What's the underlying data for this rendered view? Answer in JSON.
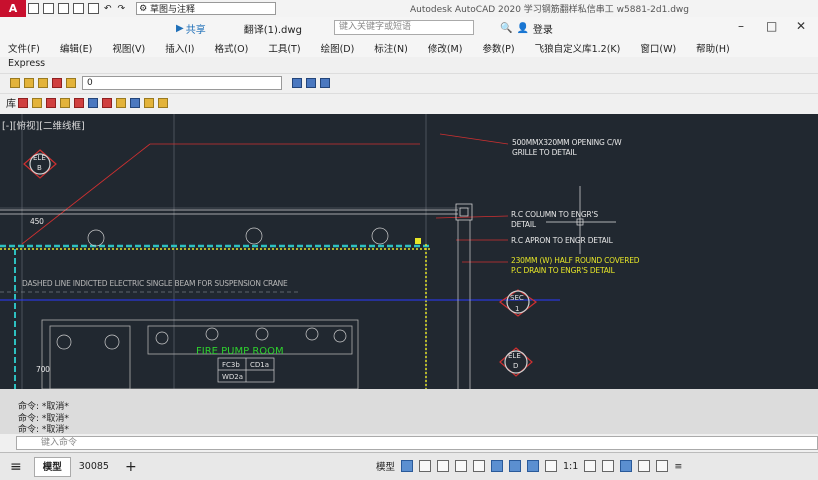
{
  "titlebar": {
    "app_logo": "A",
    "workspace": "草图与注释",
    "window_title": "Autodesk AutoCAD 2020  学习钢筋翻样私信串工    w5881-2d1.dwg"
  },
  "filetab": {
    "share_label": "共享",
    "file_name": "翻译(1).dwg",
    "search_placeholder": "键入关键字或短语",
    "login_label": "登录"
  },
  "menu": [
    "文件(F)",
    "编辑(E)",
    "视图(V)",
    "插入(I)",
    "格式(O)",
    "工具(T)",
    "绘图(D)",
    "标注(N)",
    "修改(M)",
    "参数(P)",
    "飞狼自定义库1.2(K)",
    "窗口(W)",
    "帮助(H)"
  ],
  "express_label": "Express",
  "layer": {
    "current": "0"
  },
  "toolrow2_label": "库",
  "viewport_label": "[-][俯视][二维线框]",
  "drawing": {
    "note1_line1": "500MMX320MM OPENING C/W",
    "note1_line2": "GRILLE TO DETAIL",
    "note2_line1": "R.C COLUMN TO ENGR'S",
    "note2_line2": "DETAIL",
    "note3": "R.C APRON TO ENGR DETAIL",
    "note4_line1": "230MM (W) HALF ROUND COVERED",
    "note4_line2": "P.C DRAIN TO ENGR'S DETAIL",
    "crane_note": "DASHED LINE INDICTED ELECTRIC SINGLE BEAM FOR SUSPENSION CRANE",
    "room_label": "FIRE PUMP ROOM",
    "dim_450": "450",
    "dim_700": "700",
    "ele_b_top": "ELE",
    "ele_b_bottom": "B",
    "sec_top": "SEC",
    "sec_bottom": "1",
    "ele_d_top": "ELE",
    "ele_d_bottom": "D",
    "tag1a": "FC3b",
    "tag1b": "CD1a",
    "tag2a": "WD2a"
  },
  "command": {
    "lines": [
      "命令: *取消*",
      "命令: *取消*",
      "命令: *取消*"
    ],
    "placeholder": "键入命令"
  },
  "status": {
    "tab_model": "模型",
    "tab_layout": "30085",
    "model_label": "模型",
    "scale": "1:1"
  }
}
